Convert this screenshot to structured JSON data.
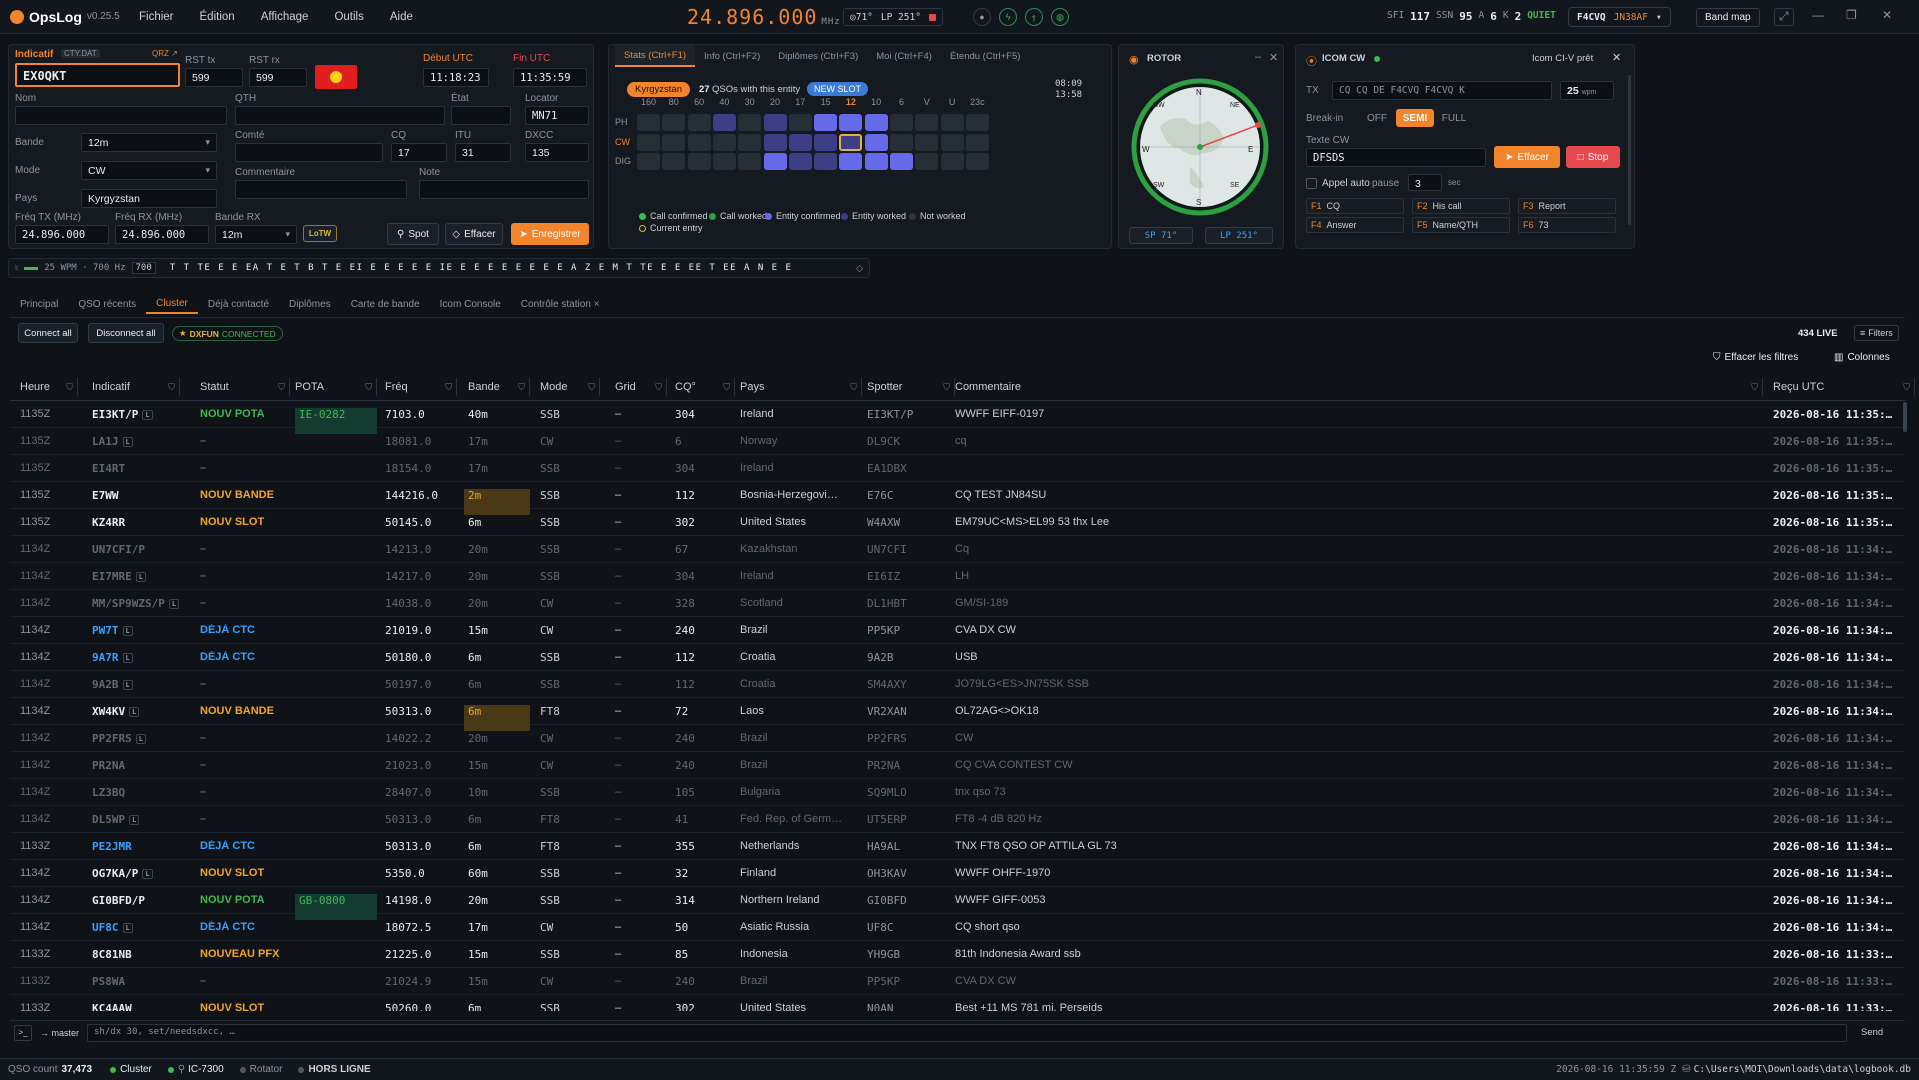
{
  "app": {
    "name": "OpsLog",
    "version": "v0.25.5"
  },
  "menu": [
    "Fichier",
    "Édition",
    "Affichage",
    "Outils",
    "Aide"
  ],
  "radio": {
    "frequency": "24.896.000",
    "unit": "MHz",
    "sp": "◎71°",
    "lp": "LP 251°"
  },
  "solar": {
    "sfi_label": "SFI",
    "sfi": "117",
    "ssn_label": "SSN",
    "ssn": "95",
    "a_label": "A",
    "a": "6",
    "k_label": "K",
    "k": "2",
    "condition": "QUIET"
  },
  "station": {
    "callsign": "F4CVQ",
    "locator": "JN38AF"
  },
  "bandmap_label": "Band map",
  "entry": {
    "callsign_label": "Indicatif",
    "cty_label": "CTY.DAT",
    "qrz_label": "QRZ ↗",
    "callsign": "EX0QKT",
    "rst_tx_label": "RST tx",
    "rst_tx": "599",
    "rst_rx_label": "RST rx",
    "rst_rx": "599",
    "start_label": "Début UTC",
    "start": "11:18:23",
    "end_label": "Fin UTC",
    "end": "11:35:59",
    "name_label": "Nom",
    "qth_label": "QTH",
    "state_label": "État",
    "locator_label": "Locator",
    "locator": "MN71",
    "band_label": "Bande",
    "band": "12m",
    "county_label": "Comté",
    "cq_label": "CQ",
    "cq": "17",
    "itu_label": "ITU",
    "itu": "31",
    "dxcc_label": "DXCC",
    "dxcc": "135",
    "mode_label": "Mode",
    "mode": "CW",
    "comment_label": "Commentaire",
    "note_label": "Note",
    "country_label": "Pays",
    "country": "Kyrgyzstan",
    "freq_tx_label": "Fréq TX (MHz)",
    "freq_tx": "24.896.000",
    "freq_rx_label": "Fréq RX (MHz)",
    "freq_rx": "24.896.000",
    "band_rx_label": "Bande RX",
    "band_rx": "12m",
    "lotw": "LoTW",
    "spot_btn": "Spot",
    "clear_btn": "Effacer",
    "save_btn": "Enregistrer"
  },
  "stats": {
    "tabs": [
      "Stats (Ctrl+F1)",
      "Info (Ctrl+F2)",
      "Diplômes (Ctrl+F3)",
      "Moi (Ctrl+F4)",
      "Étendu (Ctrl+F5)"
    ],
    "entity": "Kyrgyzstan",
    "qso_count": "27",
    "qso_text": "QSOs with this entity",
    "new_slot": "NEW SLOT",
    "time1": "08:09",
    "time2": "13:58",
    "bands": [
      "160",
      "80",
      "60",
      "40",
      "30",
      "20",
      "17",
      "15",
      "12",
      "10",
      "6",
      "V",
      "U",
      "23c"
    ],
    "modes": [
      "PH",
      "CW",
      "DIG"
    ],
    "cells": [
      [
        "n",
        "n",
        "n",
        "w",
        "n",
        "w",
        "n",
        "c",
        "c",
        "c",
        "n",
        "n",
        "n",
        "n"
      ],
      [
        "n",
        "n",
        "n",
        "n",
        "n",
        "w",
        "w",
        "w",
        "e",
        "c",
        "n",
        "n",
        "n",
        "n"
      ],
      [
        "n",
        "n",
        "n",
        "n",
        "n",
        "c",
        "w",
        "w",
        "c",
        "c",
        "c",
        "n",
        "n",
        "n"
      ]
    ],
    "legend": [
      "Call confirmed",
      "Call worked",
      "Entity confirmed",
      "Entity worked",
      "Not worked",
      "Current entry"
    ]
  },
  "rotor": {
    "title": "ROTOR",
    "sp": "SP 71°",
    "lp": "LP 251°",
    "compass": [
      "N",
      "NE",
      "E",
      "SE",
      "S",
      "SW",
      "W",
      "NW"
    ]
  },
  "icom": {
    "title": "ICOM CW",
    "status": "Icom CI-V prêt",
    "tx_label": "TX",
    "tx_text": "CQ CQ DE F4CVQ F4CVQ K",
    "wpm": "25",
    "wpm_unit": "wpm",
    "breakin_label": "Break-in",
    "breakin": [
      "OFF",
      "SEMI",
      "FULL"
    ],
    "cw_text_label": "Texte CW",
    "cw_text": "DFSDS",
    "clear": "Effacer",
    "stop": "Stop",
    "auto_call": "Appel auto",
    "pause_label": "pause",
    "pause": "3",
    "sec": "sec",
    "macros": [
      {
        "k": "F1",
        "l": "CQ"
      },
      {
        "k": "F2",
        "l": "His call"
      },
      {
        "k": "F3",
        "l": "Report"
      },
      {
        "k": "F4",
        "l": "Answer"
      },
      {
        "k": "F5",
        "l": "Name/QTH"
      },
      {
        "k": "F6",
        "l": "73"
      }
    ]
  },
  "decoder": {
    "wpm": "25 WPM · 700 Hz",
    "hz": "700",
    "text": "T T TE E E EA T E T B T E EI E E E E E IE E E E E E E E E A Z E M T TE E E EE T EE A N E E"
  },
  "main_tabs": [
    "Principal",
    "QSO récents",
    "Cluster",
    "Déjà contacté",
    "Diplômes",
    "Carte de bande",
    "Icom Console",
    "Contrôle station ×"
  ],
  "cluster": {
    "connect_all": "Connect all",
    "disconnect_all": "Disconnect all",
    "node": "DXFUN",
    "node_status": "CONNECTED",
    "live": "434 LIVE",
    "filters": "Filters",
    "clear_filters": "Effacer les filtres",
    "columns": "Colonnes"
  },
  "table": {
    "headers": [
      "Heure",
      "Indicatif",
      "Statut",
      "POTA",
      "Fréq",
      "Bande",
      "Mode",
      "Grid",
      "CQ°",
      "Pays",
      "Spotter",
      "Commentaire",
      "Reçu UTC"
    ],
    "rows": [
      {
        "t": "1135Z",
        "c": "EI3KT/P",
        "s": "NOUV POTA",
        "p": "IE-0282",
        "f": "7103.0",
        "b": "40m",
        "m": "SSB",
        "g": "–",
        "cq": "304",
        "co": "Ireland",
        "sp": "EI3KT/P",
        "cm": "WWFF EIFF-0197",
        "r": "2026-08-16 11:35:…",
        "dim": false,
        "st": "pota",
        "lt": true
      },
      {
        "t": "1135Z",
        "c": "LA1J",
        "s": "–",
        "p": "",
        "f": "18081.0",
        "b": "17m",
        "m": "CW",
        "g": "–",
        "cq": "6",
        "co": "Norway",
        "sp": "DL9CK",
        "cm": "cq",
        "r": "2026-08-16 11:35:…",
        "dim": true,
        "st": "",
        "lt": true
      },
      {
        "t": "1135Z",
        "c": "EI4RT",
        "s": "–",
        "p": "",
        "f": "18154.0",
        "b": "17m",
        "m": "SSB",
        "g": "–",
        "cq": "304",
        "co": "Ireland",
        "sp": "EA1DBX",
        "cm": "",
        "r": "2026-08-16 11:35:…",
        "dim": true,
        "st": "",
        "lt": false
      },
      {
        "t": "1135Z",
        "c": "E7WW",
        "s": "NOUV BANDE",
        "p": "",
        "f": "144216.0",
        "b": "2m",
        "m": "SSB",
        "g": "–",
        "cq": "112",
        "co": "Bosnia-Herzegovi…",
        "sp": "E76C",
        "cm": "CQ TEST JN84SU",
        "r": "2026-08-16 11:35:…",
        "dim": false,
        "st": "band",
        "lt": false
      },
      {
        "t": "1135Z",
        "c": "KZ4RR",
        "s": "NOUV SLOT",
        "p": "",
        "f": "50145.0",
        "b": "6m",
        "m": "SSB",
        "g": "–",
        "cq": "302",
        "co": "United States",
        "sp": "W4AXW",
        "cm": "EM79UC<MS>EL99 53 thx Lee",
        "r": "2026-08-16 11:35:…",
        "dim": false,
        "st": "slot",
        "lt": false
      },
      {
        "t": "1134Z",
        "c": "UN7CFI/P",
        "s": "–",
        "p": "",
        "f": "14213.0",
        "b": "20m",
        "m": "SSB",
        "g": "–",
        "cq": "67",
        "co": "Kazakhstan",
        "sp": "UN7CFI",
        "cm": "Cq",
        "r": "2026-08-16 11:34:…",
        "dim": true,
        "st": "",
        "lt": false
      },
      {
        "t": "1134Z",
        "c": "EI7MRE",
        "s": "–",
        "p": "",
        "f": "14217.0",
        "b": "20m",
        "m": "SSB",
        "g": "–",
        "cq": "304",
        "co": "Ireland",
        "sp": "EI6IZ",
        "cm": "LH",
        "r": "2026-08-16 11:34:…",
        "dim": true,
        "st": "",
        "lt": true
      },
      {
        "t": "1134Z",
        "c": "MM/SP9WZS/P",
        "s": "–",
        "p": "",
        "f": "14038.0",
        "b": "20m",
        "m": "CW",
        "g": "–",
        "cq": "328",
        "co": "Scotland",
        "sp": "DL1HBT",
        "cm": "GM/SI-189",
        "r": "2026-08-16 11:34:…",
        "dim": true,
        "st": "",
        "lt": true
      },
      {
        "t": "1134Z",
        "c": "PW7T",
        "s": "DÉJÀ CTC",
        "p": "",
        "f": "21019.0",
        "b": "15m",
        "m": "CW",
        "g": "–",
        "cq": "240",
        "co": "Brazil",
        "sp": "PP5KP",
        "cm": "CVA DX CW",
        "r": "2026-08-16 11:34:…",
        "dim": false,
        "st": "ctc",
        "lt": true
      },
      {
        "t": "1134Z",
        "c": "9A7R",
        "s": "DÉJÀ CTC",
        "p": "",
        "f": "50180.0",
        "b": "6m",
        "m": "SSB",
        "g": "–",
        "cq": "112",
        "co": "Croatia",
        "sp": "9A2B",
        "cm": "USB",
        "r": "2026-08-16 11:34:…",
        "dim": false,
        "st": "ctc",
        "lt": true
      },
      {
        "t": "1134Z",
        "c": "9A2B",
        "s": "–",
        "p": "",
        "f": "50197.0",
        "b": "6m",
        "m": "SSB",
        "g": "–",
        "cq": "112",
        "co": "Croatia",
        "sp": "SM4AXY",
        "cm": "JO79LG<ES>JN75SK SSB",
        "r": "2026-08-16 11:34:…",
        "dim": true,
        "st": "",
        "lt": true
      },
      {
        "t": "1134Z",
        "c": "XW4KV",
        "s": "NOUV BANDE",
        "p": "",
        "f": "50313.0",
        "b": "6m",
        "m": "FT8",
        "g": "–",
        "cq": "72",
        "co": "Laos",
        "sp": "VR2XAN",
        "cm": "OL72AG<>OK18",
        "r": "2026-08-16 11:34:…",
        "dim": false,
        "st": "band",
        "lt": true
      },
      {
        "t": "1134Z",
        "c": "PP2FRS",
        "s": "–",
        "p": "",
        "f": "14022.2",
        "b": "20m",
        "m": "CW",
        "g": "–",
        "cq": "240",
        "co": "Brazil",
        "sp": "PP2FRS",
        "cm": "CW",
        "r": "2026-08-16 11:34:…",
        "dim": true,
        "st": "",
        "lt": true
      },
      {
        "t": "1134Z",
        "c": "PR2NA",
        "s": "–",
        "p": "",
        "f": "21023.0",
        "b": "15m",
        "m": "CW",
        "g": "–",
        "cq": "240",
        "co": "Brazil",
        "sp": "PR2NA",
        "cm": "CQ CVA CONTEST CW",
        "r": "2026-08-16 11:34:…",
        "dim": true,
        "st": "",
        "lt": false
      },
      {
        "t": "1134Z",
        "c": "LZ3BQ",
        "s": "–",
        "p": "",
        "f": "28407.0",
        "b": "10m",
        "m": "SSB",
        "g": "–",
        "cq": "105",
        "co": "Bulgaria",
        "sp": "SQ9MLO",
        "cm": "tnx qso 73",
        "r": "2026-08-16 11:34:…",
        "dim": true,
        "st": "",
        "lt": false
      },
      {
        "t": "1134Z",
        "c": "DL5WP",
        "s": "–",
        "p": "",
        "f": "50313.0",
        "b": "6m",
        "m": "FT8",
        "g": "–",
        "cq": "41",
        "co": "Fed. Rep. of Germ…",
        "sp": "UT5ERP",
        "cm": "FT8 -4 dB 820 Hz",
        "r": "2026-08-16 11:34:…",
        "dim": true,
        "st": "",
        "lt": true
      },
      {
        "t": "1133Z",
        "c": "PE2JMR",
        "s": "DÉJÀ CTC",
        "p": "",
        "f": "50313.0",
        "b": "6m",
        "m": "FT8",
        "g": "–",
        "cq": "355",
        "co": "Netherlands",
        "sp": "HA9AL",
        "cm": "TNX FT8 QSO OP ATTILA GL 73",
        "r": "2026-08-16 11:34:…",
        "dim": false,
        "st": "ctc",
        "lt": false
      },
      {
        "t": "1134Z",
        "c": "OG7KA/P",
        "s": "NOUV SLOT",
        "p": "",
        "f": "5350.0",
        "b": "60m",
        "m": "SSB",
        "g": "–",
        "cq": "32",
        "co": "Finland",
        "sp": "OH3KAV",
        "cm": "WWFF OHFF-1970",
        "r": "2026-08-16 11:34:…",
        "dim": false,
        "st": "slot",
        "lt": true
      },
      {
        "t": "1134Z",
        "c": "GI0BFD/P",
        "s": "NOUV POTA",
        "p": "GB-0800",
        "f": "14198.0",
        "b": "20m",
        "m": "SSB",
        "g": "–",
        "cq": "314",
        "co": "Northern Ireland",
        "sp": "GI0BFD",
        "cm": "WWFF GIFF-0053",
        "r": "2026-08-16 11:34:…",
        "dim": false,
        "st": "pota",
        "lt": false
      },
      {
        "t": "1134Z",
        "c": "UF8C",
        "s": "DÉJÀ CTC",
        "p": "",
        "f": "18072.5",
        "b": "17m",
        "m": "CW",
        "g": "–",
        "cq": "50",
        "co": "Asiatic Russia",
        "sp": "UF8C",
        "cm": "CQ short qso",
        "r": "2026-08-16 11:34:…",
        "dim": false,
        "st": "ctc",
        "lt": true
      },
      {
        "t": "1133Z",
        "c": "8C81NB",
        "s": "NOUVEAU PFX",
        "p": "",
        "f": "21225.0",
        "b": "15m",
        "m": "SSB",
        "g": "–",
        "cq": "85",
        "co": "Indonesia",
        "sp": "YH9GB",
        "cm": "81th Indonesia Award ssb",
        "r": "2026-08-16 11:33:…",
        "dim": false,
        "st": "pfx",
        "lt": false
      },
      {
        "t": "1133Z",
        "c": "PS8WA",
        "s": "–",
        "p": "",
        "f": "21024.9",
        "b": "15m",
        "m": "CW",
        "g": "–",
        "cq": "240",
        "co": "Brazil",
        "sp": "PP5KP",
        "cm": "CVA DX CW",
        "r": "2026-08-16 11:33:…",
        "dim": true,
        "st": "",
        "lt": false
      },
      {
        "t": "1133Z",
        "c": "KC4AAW",
        "s": "NOUV SLOT",
        "p": "",
        "f": "50260.0",
        "b": "6m",
        "m": "SSB",
        "g": "–",
        "cq": "302",
        "co": "United States",
        "sp": "N0AN",
        "cm": "Best +11 MS 781 mi. Perseids",
        "r": "2026-08-16 11:33:…",
        "dim": false,
        "st": "slot",
        "lt": false
      }
    ]
  },
  "cmd": {
    "prompt": ">_",
    "branch": "→ master",
    "text": "sh/dx 30, set/needsdxcc, …",
    "send": "Send"
  },
  "status": {
    "qso_label": "QSO count",
    "qso_count": "37,473",
    "cluster": "Cluster",
    "rig": "IC-7300",
    "rotator": "Rotator",
    "offline": "HORS LIGNE",
    "datetime": "2026-08-16 11:35:59 Z",
    "db": "C:\\Users\\MOI\\Downloads\\data\\logbook.db"
  },
  "colors": {
    "accent": "#f2842b",
    "confirmed": "#6669e8",
    "worked": "#3d3f86",
    "pota": "#3fb950",
    "band": "#f2a52b",
    "ctc": "#3aa0ff",
    "slot": "#f2a52b"
  }
}
